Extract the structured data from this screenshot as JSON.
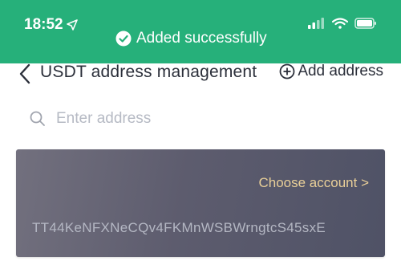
{
  "status_bar": {
    "time": "18:52"
  },
  "toast": {
    "message": "Added successfully",
    "background_color": "#26b07a"
  },
  "header": {
    "title": "USDT address management",
    "add_address_label": "Add address"
  },
  "search": {
    "placeholder": "Enter address",
    "value": ""
  },
  "address_card": {
    "choose_account_label": "Choose account >",
    "address": "TT44KeNFXNeCQv4FKMnWSBWrngtcS45sxE",
    "accent_color": "#e9cf98"
  },
  "icons": {
    "toast_icon": "check-circle-icon",
    "status_icons": [
      "location-arrow-icon",
      "signal-icon",
      "wifi-icon",
      "battery-icon"
    ],
    "nav_icons": [
      "back-chevron-icon",
      "add-circle-icon"
    ],
    "search_icon": "search-icon"
  }
}
